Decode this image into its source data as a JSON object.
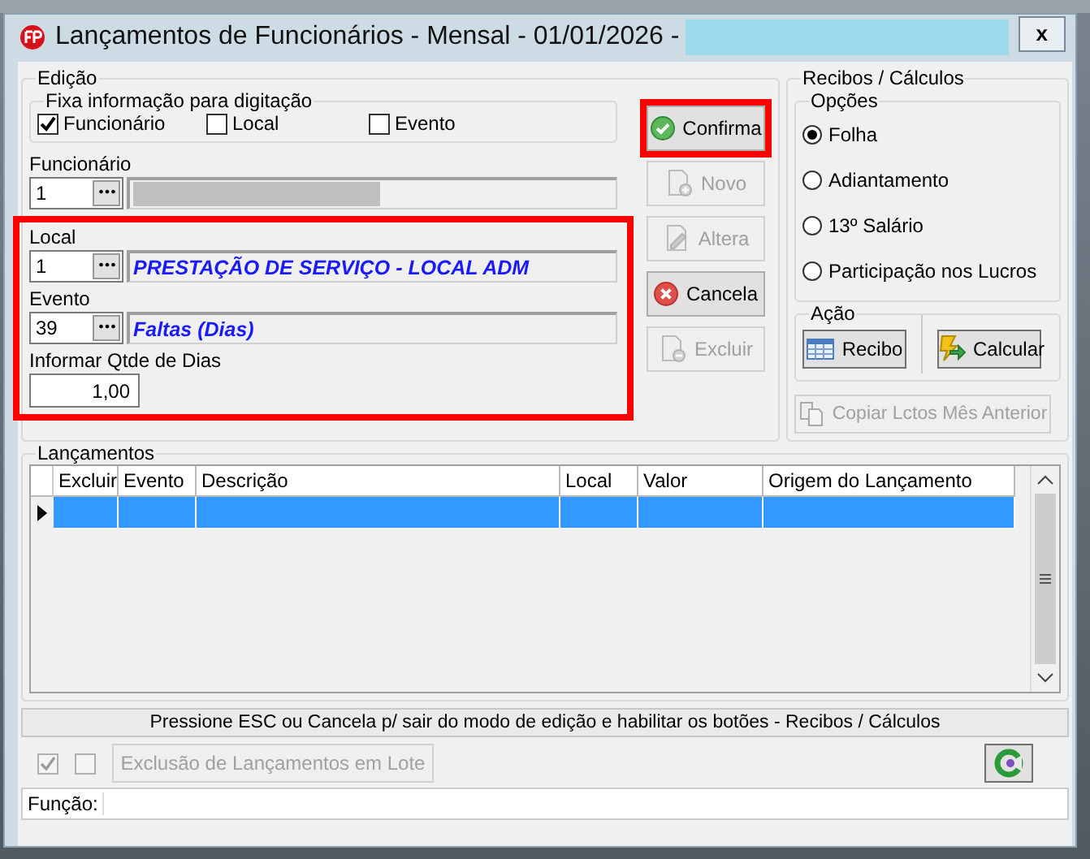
{
  "window": {
    "title": "Lançamentos de Funcionários - Mensal -  01/01/2026 -",
    "close": "x"
  },
  "edicao": {
    "title": "Edição",
    "fixa": {
      "title": "Fixa informação para digitação",
      "options": [
        {
          "label": "Funcionário",
          "checked": true
        },
        {
          "label": "Local",
          "checked": false
        },
        {
          "label": "Evento",
          "checked": false
        }
      ]
    },
    "fields": [
      {
        "kind": "lookup",
        "label": "Funcionário",
        "code": "1",
        "lookup_button": "•••"
      }
    ],
    "highlighted_fields": [
      {
        "kind": "lookup",
        "label": "Local",
        "code": "1",
        "lookup_button": "•••",
        "description": "PRESTAÇÃO DE SERVIÇO - LOCAL ADM"
      },
      {
        "kind": "lookup",
        "label": "Evento",
        "code": "39",
        "lookup_button": "•••",
        "description": "Faltas (Dias)"
      },
      {
        "kind": "number",
        "label": "Informar Qtde de Dias",
        "value": "1,00"
      }
    ],
    "buttons": [
      {
        "label": "Confirma",
        "disabled": false,
        "highlighted": true
      },
      {
        "label": "Novo",
        "disabled": true,
        "highlighted": false
      },
      {
        "label": "Altera",
        "disabled": true,
        "highlighted": false
      },
      {
        "label": "Cancela",
        "disabled": false,
        "highlighted": false
      },
      {
        "label": "Excluir",
        "disabled": true,
        "highlighted": false
      }
    ]
  },
  "recibos": {
    "title": "Recibos / Cálculos",
    "opcoes": {
      "title": "Opções",
      "options": [
        {
          "label": "Folha",
          "selected": true
        },
        {
          "label": "Adiantamento",
          "selected": false
        },
        {
          "label": "13º Salário",
          "selected": false
        },
        {
          "label": "Participação nos Lucros",
          "selected": false
        }
      ]
    },
    "acao": {
      "title": "Ação",
      "buttons": [
        {
          "label": "Recibo",
          "disabled": false
        },
        {
          "label": "Calcular",
          "disabled": false
        }
      ]
    },
    "copy_button": {
      "label": "Copiar Lctos Mês Anterior",
      "disabled": true
    }
  },
  "lancamentos": {
    "title": "Lançamentos",
    "columns": [
      "Excluir",
      "Evento",
      "Descrição",
      "Local",
      "Valor",
      "Origem do Lançamento"
    ],
    "rows": [
      {
        "selected": true
      }
    ]
  },
  "status_bar": "Pressione ESC ou Cancela p/ sair do modo de edição e habilitar os botões - Recibos / Cálculos",
  "bottom": {
    "checks": [
      {
        "checked": true,
        "disabled": true
      },
      {
        "checked": false,
        "disabled": true
      }
    ],
    "lote_button": {
      "label": "Exclusão de Lançamentos em Lote",
      "disabled": true
    }
  },
  "funcao": {
    "label": "Função:"
  }
}
